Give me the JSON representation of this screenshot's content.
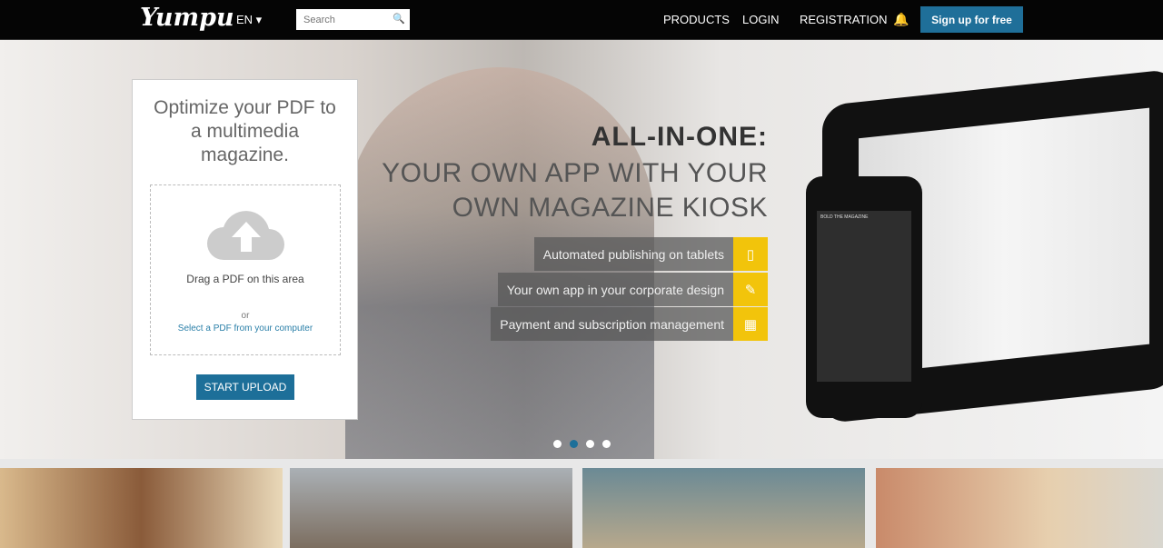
{
  "nav": {
    "logo": "Yumpu",
    "lang": "EN ▾",
    "search_placeholder": "Search",
    "links": [
      "PRODUCTS",
      "LOGIN",
      "REGISTRATION"
    ],
    "signup": "Sign up for free"
  },
  "upload": {
    "title": "Optimize your PDF to a multimedia magazine.",
    "drag": "Drag a PDF on this area",
    "or": "or",
    "select": "Select a PDF from your computer",
    "button": "START UPLOAD"
  },
  "hero": {
    "headline": "ALL-IN-ONE:",
    "subline1": "YOUR OWN APP WITH YOUR",
    "subline2": "OWN MAGAZINE KIOSK",
    "features": [
      {
        "label": "Automated publishing on tablets",
        "icon": "tablet-icon"
      },
      {
        "label": "Your own app in your corporate design",
        "icon": "pencil-icon"
      },
      {
        "label": "Payment and subscription management",
        "icon": "calendar-icon"
      }
    ],
    "phone_title": "BOLD THE MAGAZINE",
    "slides": 4,
    "active_slide": 2
  },
  "colors": {
    "accent": "#1d6f99",
    "feature": "#f2c40b"
  }
}
